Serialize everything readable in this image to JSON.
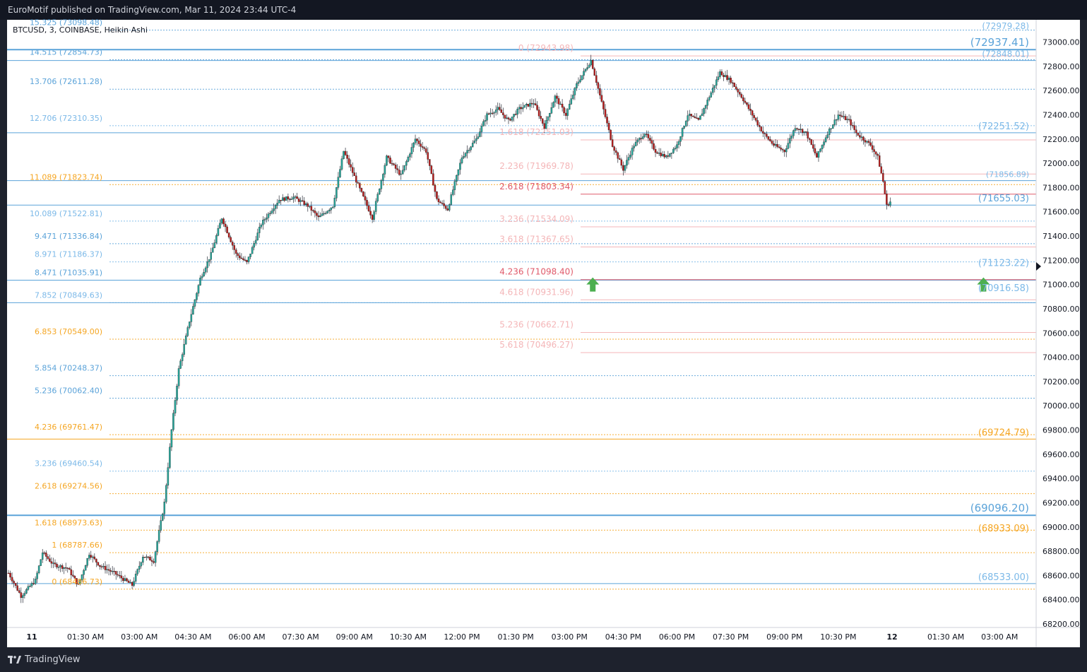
{
  "header": {
    "publisher_text": "EuroMotif published on TradingView.com, Mar 11, 2024 23:44 UTC-4"
  },
  "footer": {
    "brand": "TradingView"
  },
  "chart_data": {
    "type": "candlestick",
    "title": "BTCUSD, 3, COINBASE, Heikin Ashi",
    "symbol": "BTCUSD",
    "interval": "3",
    "exchange": "COINBASE",
    "style": "Heikin Ashi",
    "ylim": [
      68100,
      73150
    ],
    "y_ticks": [
      73000,
      72800,
      72600,
      72400,
      72200,
      72000,
      71800,
      71600,
      71400,
      71200,
      71000,
      70800,
      70600,
      70400,
      70200,
      70000,
      69800,
      69600,
      69400,
      69200,
      69000,
      68800,
      68600,
      68400,
      68200
    ],
    "x_ticks": [
      {
        "label": "11",
        "t": 0
      },
      {
        "label": "01:30 AM",
        "t": 1.5
      },
      {
        "label": "03:00 AM",
        "t": 3
      },
      {
        "label": "04:30 AM",
        "t": 4.5
      },
      {
        "label": "06:00 AM",
        "t": 6
      },
      {
        "label": "07:30 AM",
        "t": 7.5
      },
      {
        "label": "09:00 AM",
        "t": 9
      },
      {
        "label": "10:30 AM",
        "t": 10.5
      },
      {
        "label": "12:00 PM",
        "t": 12
      },
      {
        "label": "01:30 PM",
        "t": 13.5
      },
      {
        "label": "03:00 PM",
        "t": 15
      },
      {
        "label": "04:30 PM",
        "t": 16.5
      },
      {
        "label": "06:00 PM",
        "t": 18
      },
      {
        "label": "07:30 PM",
        "t": 19.5
      },
      {
        "label": "09:00 PM",
        "t": 21
      },
      {
        "label": "10:30 PM",
        "t": 22.5
      },
      {
        "label": "12",
        "t": 24
      },
      {
        "label": "01:30 AM",
        "t": 25.5
      },
      {
        "label": "03:00 AM",
        "t": 27
      }
    ],
    "x_range": [
      -0.65,
      28.15
    ],
    "price_path": [
      {
        "t": -0.65,
        "p": 68620
      },
      {
        "t": -0.3,
        "p": 68430
      },
      {
        "t": 0.1,
        "p": 68560
      },
      {
        "t": 0.3,
        "p": 68790
      },
      {
        "t": 0.6,
        "p": 68690
      },
      {
        "t": 1.0,
        "p": 68660
      },
      {
        "t": 1.3,
        "p": 68520
      },
      {
        "t": 1.6,
        "p": 68780
      },
      {
        "t": 1.9,
        "p": 68680
      },
      {
        "t": 2.3,
        "p": 68620
      },
      {
        "t": 2.8,
        "p": 68520
      },
      {
        "t": 3.1,
        "p": 68760
      },
      {
        "t": 3.4,
        "p": 68720
      },
      {
        "t": 3.7,
        "p": 69200
      },
      {
        "t": 3.9,
        "p": 69800
      },
      {
        "t": 4.1,
        "p": 70300
      },
      {
        "t": 4.4,
        "p": 70700
      },
      {
        "t": 4.7,
        "p": 71050
      },
      {
        "t": 5.0,
        "p": 71250
      },
      {
        "t": 5.3,
        "p": 71550
      },
      {
        "t": 5.7,
        "p": 71250
      },
      {
        "t": 6.0,
        "p": 71180
      },
      {
        "t": 6.4,
        "p": 71500
      },
      {
        "t": 6.9,
        "p": 71700
      },
      {
        "t": 7.3,
        "p": 71720
      },
      {
        "t": 7.7,
        "p": 71650
      },
      {
        "t": 8.0,
        "p": 71550
      },
      {
        "t": 8.4,
        "p": 71650
      },
      {
        "t": 8.7,
        "p": 72100
      },
      {
        "t": 9.1,
        "p": 71820
      },
      {
        "t": 9.5,
        "p": 71550
      },
      {
        "t": 9.9,
        "p": 72050
      },
      {
        "t": 10.3,
        "p": 71900
      },
      {
        "t": 10.7,
        "p": 72200
      },
      {
        "t": 11.0,
        "p": 72100
      },
      {
        "t": 11.3,
        "p": 71700
      },
      {
        "t": 11.6,
        "p": 71620
      },
      {
        "t": 12.0,
        "p": 72050
      },
      {
        "t": 12.4,
        "p": 72200
      },
      {
        "t": 12.7,
        "p": 72400
      },
      {
        "t": 13.0,
        "p": 72450
      },
      {
        "t": 13.3,
        "p": 72350
      },
      {
        "t": 13.6,
        "p": 72450
      },
      {
        "t": 14.0,
        "p": 72500
      },
      {
        "t": 14.3,
        "p": 72300
      },
      {
        "t": 14.6,
        "p": 72550
      },
      {
        "t": 14.9,
        "p": 72400
      },
      {
        "t": 15.2,
        "p": 72650
      },
      {
        "t": 15.6,
        "p": 72850
      },
      {
        "t": 15.9,
        "p": 72500
      },
      {
        "t": 16.2,
        "p": 72150
      },
      {
        "t": 16.5,
        "p": 71950
      },
      {
        "t": 16.8,
        "p": 72150
      },
      {
        "t": 17.1,
        "p": 72250
      },
      {
        "t": 17.4,
        "p": 72100
      },
      {
        "t": 17.7,
        "p": 72050
      },
      {
        "t": 18.0,
        "p": 72150
      },
      {
        "t": 18.3,
        "p": 72400
      },
      {
        "t": 18.6,
        "p": 72350
      },
      {
        "t": 18.9,
        "p": 72550
      },
      {
        "t": 19.2,
        "p": 72750
      },
      {
        "t": 19.5,
        "p": 72680
      },
      {
        "t": 19.8,
        "p": 72550
      },
      {
        "t": 20.1,
        "p": 72400
      },
      {
        "t": 20.4,
        "p": 72250
      },
      {
        "t": 20.7,
        "p": 72150
      },
      {
        "t": 21.0,
        "p": 72100
      },
      {
        "t": 21.3,
        "p": 72300
      },
      {
        "t": 21.6,
        "p": 72250
      },
      {
        "t": 21.9,
        "p": 72050
      },
      {
        "t": 22.2,
        "p": 72250
      },
      {
        "t": 22.5,
        "p": 72400
      },
      {
        "t": 22.8,
        "p": 72350
      },
      {
        "t": 23.0,
        "p": 72250
      },
      {
        "t": 23.2,
        "p": 72200
      },
      {
        "t": 23.4,
        "p": 72150
      },
      {
        "t": 23.6,
        "p": 72050
      },
      {
        "t": 23.75,
        "p": 71850
      },
      {
        "t": 23.85,
        "p": 71650
      },
      {
        "t": 24.0,
        "p": 71700
      }
    ],
    "fib_levels_left": [
      {
        "label": "15.325 (73098.48)",
        "price": 73098.48,
        "color": "#5ba3d9"
      },
      {
        "label": "14.515 (72854.73)",
        "price": 72854.73,
        "color": "#5ba3d9"
      },
      {
        "label": "13.706 (72611.28)",
        "price": 72611.28,
        "color": "#5ba3d9"
      },
      {
        "label": "12.706 (72310.35)",
        "price": 72310.35,
        "color": "#7cb9e8"
      },
      {
        "label": "11.089 (71823.74)",
        "price": 71823.74,
        "color": "#f5a623"
      },
      {
        "label": "10.089 (71522.81)",
        "price": 71522.81,
        "color": "#7cb9e8"
      },
      {
        "label": "9.471 (71336.84)",
        "price": 71336.84,
        "color": "#5ba3d9"
      },
      {
        "label": "8.971 (71186.37)",
        "price": 71186.37,
        "color": "#7cb9e8"
      },
      {
        "label": "8.471 (71035.91)",
        "price": 71035.91,
        "color": "#5ba3d9"
      },
      {
        "label": "7.852 (70849.63)",
        "price": 70849.63,
        "color": "#7cb9e8"
      },
      {
        "label": "6.853 (70549.00)",
        "price": 70549.0,
        "color": "#f5a623"
      },
      {
        "label": "5.854 (70248.37)",
        "price": 70248.37,
        "color": "#5ba3d9"
      },
      {
        "label": "5.236 (70062.40)",
        "price": 70062.4,
        "color": "#5ba3d9"
      },
      {
        "label": "4.236 (69761.47)",
        "price": 69761.47,
        "color": "#f5a623"
      },
      {
        "label": "3.236 (69460.54)",
        "price": 69460.54,
        "color": "#7cb9e8"
      },
      {
        "label": "2.618 (69274.56)",
        "price": 69274.56,
        "color": "#f5a623"
      },
      {
        "label": "1.618 (68973.63)",
        "price": 68973.63,
        "color": "#f5a623"
      },
      {
        "label": "1 (68787.66)",
        "price": 68787.66,
        "color": "#f5a623"
      },
      {
        "label": "0 (68486.73)",
        "price": 68486.73,
        "color": "#f5a623"
      }
    ],
    "fib_levels_right": [
      {
        "label": "0 (72943.98)",
        "price": 72943.98,
        "color": "#f4b6b8"
      },
      {
        "label": "1.618 (72251.03)",
        "price": 72251.03,
        "color": "#f4b6b8"
      },
      {
        "label": "2.236 (71969.78)",
        "price": 71969.78,
        "color": "#f4b6b8"
      },
      {
        "label": "2.618 (71803.34)",
        "price": 71803.34,
        "color": "#e05a6a"
      },
      {
        "label": "3.236 (71534.09)",
        "price": 71534.09,
        "color": "#f4b6b8"
      },
      {
        "label": "3.618 (71367.65)",
        "price": 71367.65,
        "color": "#f4b6b8"
      },
      {
        "label": "4.236 (71098.40)",
        "price": 71098.4,
        "color": "#e05a6a"
      },
      {
        "label": "4.618 (70931.96)",
        "price": 70931.96,
        "color": "#f4b6b8"
      },
      {
        "label": "5.236 (70662.71)",
        "price": 70662.71,
        "color": "#f4b6b8"
      },
      {
        "label": "5.618 (70496.27)",
        "price": 70496.27,
        "color": "#f4b6b8"
      }
    ],
    "levels_far_right": [
      {
        "label": "(72979.28)",
        "price": 73079.28,
        "color": "#7cb9e8",
        "size": 12
      },
      {
        "label": "(72937.41)",
        "price": 72937.41,
        "color": "#5ba3d9",
        "size": 15
      },
      {
        "label": "(72848.01)",
        "price": 72848.01,
        "color": "#7cb9e8",
        "size": 12
      },
      {
        "label": "(72251.52)",
        "price": 72251.52,
        "color": "#7cb9e8",
        "size": 13
      },
      {
        "label": "(71856.89)",
        "price": 71856.89,
        "color": "#7cb9e8",
        "size": 11
      },
      {
        "label": "(71655.03)",
        "price": 71655.03,
        "color": "#5ba3d9",
        "size": 13
      },
      {
        "label": "(71123.22)",
        "price": 71123.22,
        "color": "#7cb9e8",
        "size": 13
      },
      {
        "label": "(70916.58)",
        "price": 70916.58,
        "color": "#7cb9e8",
        "size": 13
      },
      {
        "label": "(69724.79)",
        "price": 69724.79,
        "color": "#f5a623",
        "size": 13
      },
      {
        "label": "(69096.20)",
        "price": 69096.2,
        "color": "#5ba3d9",
        "size": 15
      },
      {
        "label": "(68933.09)",
        "price": 68933.09,
        "color": "#f5a623",
        "size": 13
      },
      {
        "label": "(68533.00)",
        "price": 68533.0,
        "color": "#7cb9e8",
        "size": 13
      }
    ],
    "markers": [
      {
        "type": "arrow-up",
        "t": 15.65,
        "price": 71000,
        "color": "#4caf50"
      },
      {
        "type": "arrow-up",
        "t": 26.55,
        "price": 71000,
        "color": "#4caf50"
      }
    ],
    "colors": {
      "up": "#26a69a",
      "down": "#b71c1c",
      "grid": "#ffffff",
      "background": "#ffffff",
      "axis_text": "#131722"
    }
  }
}
